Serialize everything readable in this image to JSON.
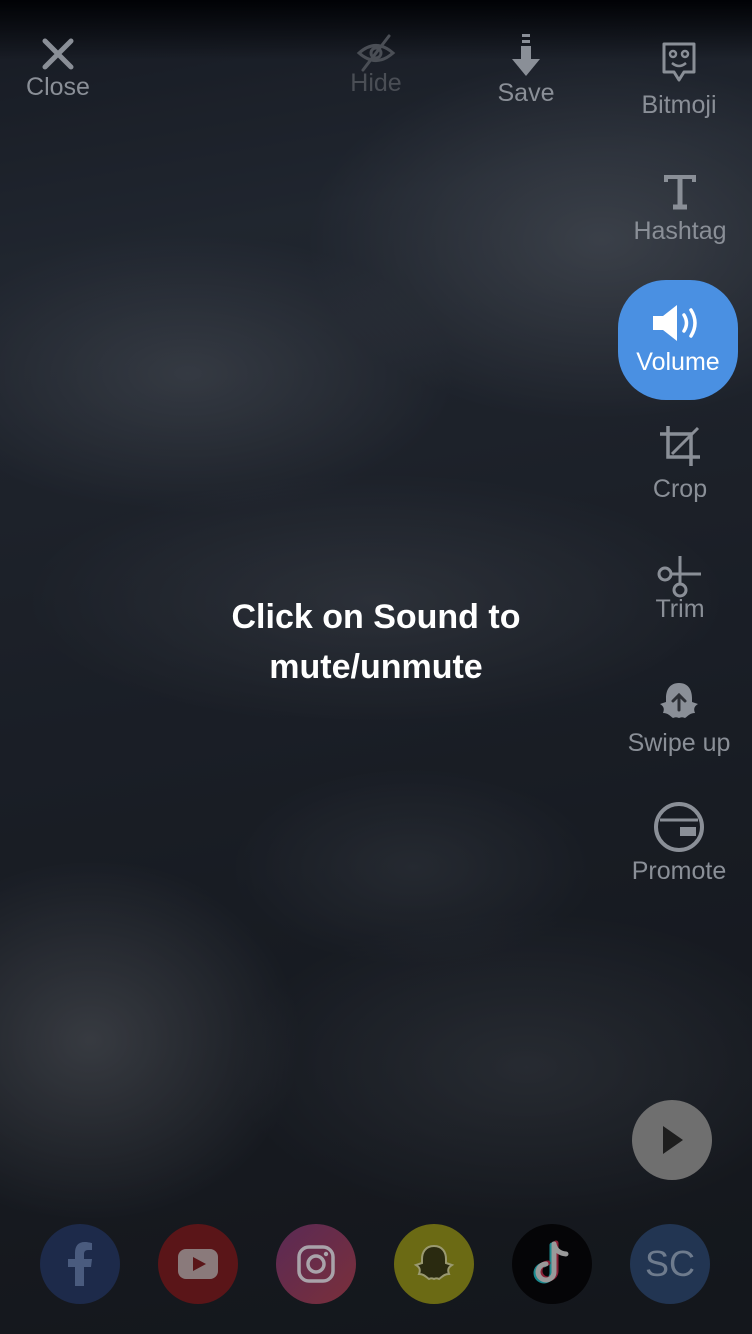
{
  "toolbar": {
    "close_label": "Close",
    "hide_label": "Hide",
    "save_label": "Save",
    "bitmoji_label": "Bitmoji"
  },
  "side_tools": {
    "hashtag_label": "Hashtag",
    "volume_label": "Volume",
    "crop_label": "Crop",
    "trim_label": "Trim",
    "swipe_up_label": "Swipe up",
    "promote_label": "Promote"
  },
  "hint": {
    "line1": "Click on Sound to",
    "line2": "mute/unmute"
  },
  "share": {
    "snapchat_code_label": "SC",
    "icons": [
      "facebook-icon",
      "youtube-icon",
      "instagram-icon",
      "snapchat-icon",
      "tiktok-icon"
    ]
  },
  "colors": {
    "accent": "#4a90e2",
    "facebook": "#1d2a4a",
    "youtube": "#5a1518",
    "instagram": "#6a2d3f",
    "snapchat": "#6b6a14",
    "tiktok": "#050507",
    "sc": "#223552"
  }
}
